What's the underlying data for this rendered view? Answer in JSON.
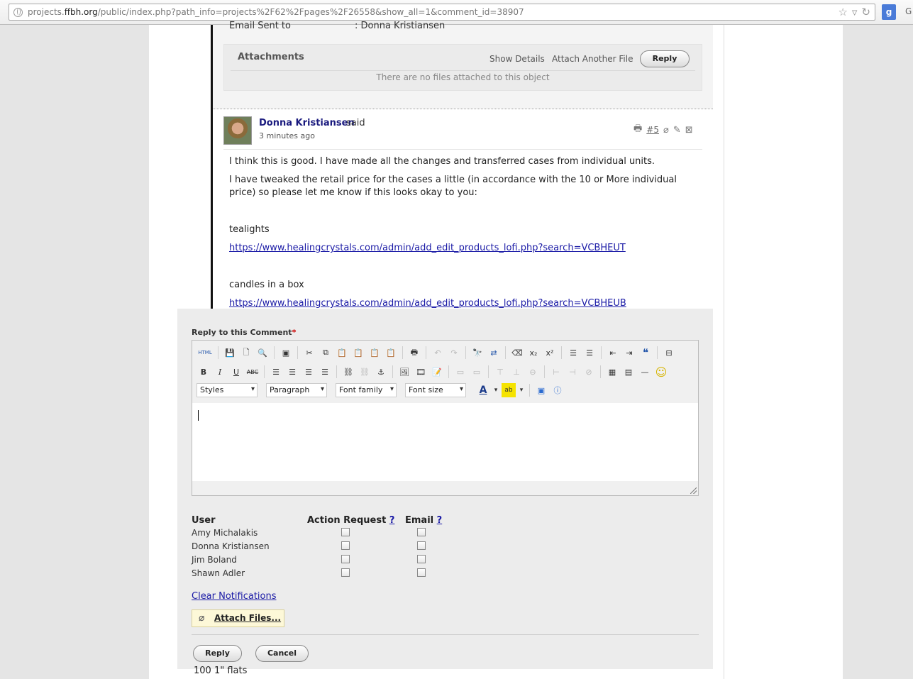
{
  "browser": {
    "url_host": "projects.",
    "url_domain": "ffbh.org",
    "url_path": "/public/index.php?path_info=projects%2F62%2Fpages%2F26558&show_all=1&comment_id=38907",
    "g_text": "G"
  },
  "previous_comment": {
    "email_sent_label": "Email Sent to",
    "email_sent_value": ": Donna Kristiansen",
    "attachments_title": "Attachments",
    "show_details": "Show Details",
    "attach_another": "Attach Another File",
    "reply_label": "Reply",
    "no_files": "There are no files attached to this object"
  },
  "comment": {
    "author": "Donna Kristiansen",
    "said": "said",
    "time": "3 minutes ago",
    "number": "#5",
    "para1": "I think this is good.  I have made all the changes and transferred cases from individual units.",
    "para2_line1": "I have tweaked the retail price for the cases a little (in accordance with the 10 or More individual",
    "para2_line2": "price) so please let me know if this looks okay to you:",
    "item1": "tealights",
    "link1": "https://www.healingcrystals.com/admin/add_edit_products_lofi.php?search=VCBHEUT",
    "item2": "candles in a box",
    "link2": "https://www.healingcrystals.com/admin/add_edit_products_lofi.php?search=VCBHEUB",
    "footer": "100 1\" flats"
  },
  "reply_form": {
    "title": "Reply to this Comment",
    "required_mark": "*",
    "toolbar": {
      "styles": "Styles",
      "paragraph": "Paragraph",
      "font_family": "Font family",
      "font_size": "Font size",
      "html": "HTML",
      "abc": "ABC"
    },
    "notifications": {
      "col_user": "User",
      "col_action": "Action Request",
      "col_email": "Email",
      "help": "?",
      "users": [
        "Amy Michalakis",
        "Donna Kristiansen",
        "Jim Boland",
        "Shawn Adler"
      ]
    },
    "clear_notifications": "Clear Notifications",
    "attach_files": "Attach Files...",
    "reply_button": "Reply",
    "cancel_button": "Cancel"
  }
}
